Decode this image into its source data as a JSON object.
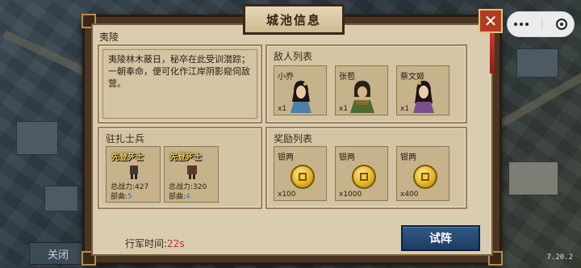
{
  "dialog": {
    "title": "城池信息",
    "close_label": "✕"
  },
  "city": {
    "name": "夷陵",
    "description": "夷陵林木蔽日，秘卒在此受训潜踪；一朝奉命，便可化作江岸阴影窥伺敌营。"
  },
  "enemies": {
    "title": "敌人列表",
    "items": [
      {
        "name": "小乔",
        "count": "x1"
      },
      {
        "name": "张苞",
        "count": "x1"
      },
      {
        "name": "蔡文姬",
        "count": "x1"
      }
    ]
  },
  "garrison": {
    "title": "驻扎士兵",
    "items": [
      {
        "name": "先登死士",
        "power_label": "总战力:",
        "power": "427",
        "unit_label": "部曲:",
        "unit": "5"
      },
      {
        "name": "先登死士",
        "power_label": "总战力:",
        "power": "320",
        "unit_label": "部曲:",
        "unit": "4"
      }
    ]
  },
  "rewards": {
    "title": "奖励列表",
    "items": [
      {
        "name": "银两",
        "count": "x100"
      },
      {
        "name": "银两",
        "count": "x1000"
      },
      {
        "name": "银两",
        "count": "x400"
      }
    ]
  },
  "march": {
    "label": "行军时间:",
    "time": "22s"
  },
  "trial_button": "试阵",
  "background": {
    "close_button": "关闭",
    "version": "7.20.2"
  },
  "colors": {
    "accent_red": "#b33a22",
    "button_blue": "#2f5a86",
    "time_red": "#c8322a",
    "unit_blue": "#3a6fb8"
  },
  "icons": [
    "more-dots-icon",
    "target-icon",
    "close-icon",
    "silver-coin-icon"
  ]
}
